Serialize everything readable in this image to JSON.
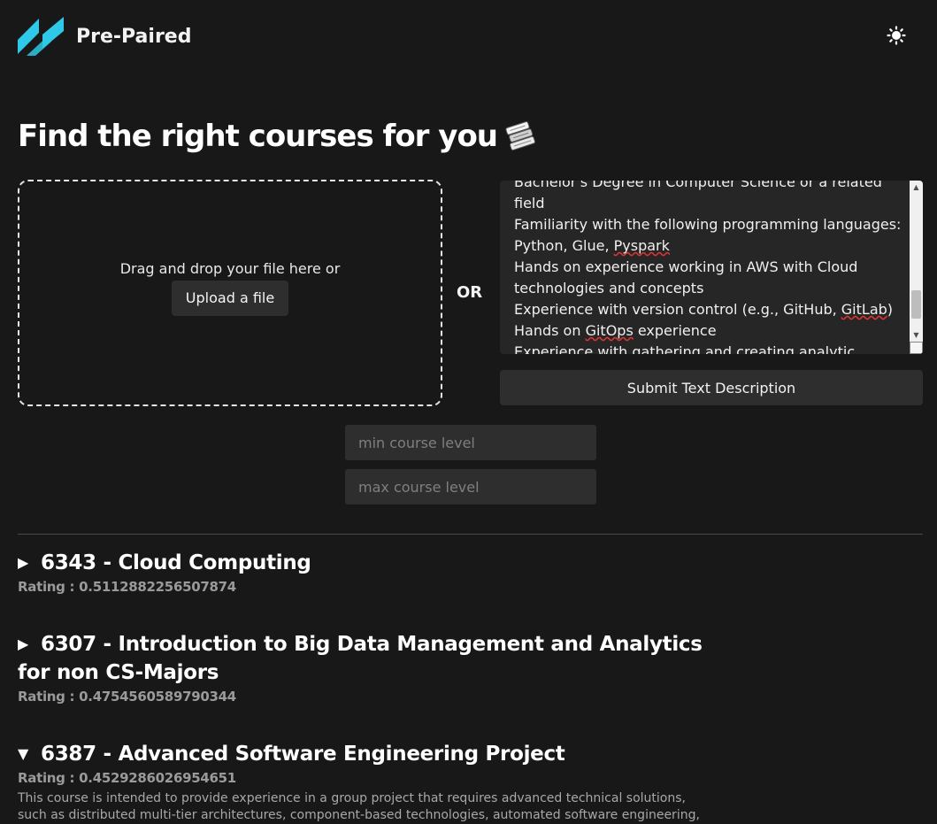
{
  "app": {
    "brand": "Pre-Paired",
    "accent_color": "#2ec9e8",
    "theme_toggle_icon": "sun-icon"
  },
  "main": {
    "title": "Find the right courses for you",
    "title_icon": "books-icon"
  },
  "upload": {
    "prompt": "Drag and drop your file here or",
    "button_label": "Upload a file"
  },
  "or_label": "OR",
  "description": {
    "lines": [
      "Bachelor's Degree in Computer Science or a related field",
      "Familiarity with the following programming languages: Python, Glue, Pyspark",
      "Hands on experience working in AWS with Cloud technologies and concepts",
      "Experience with version control (e.g., GitHub, GitLab)",
      "Hands on GitOps experience",
      "Experience with gathering and creating analytic business requirements, researching potential data"
    ],
    "submit_label": "Submit Text Description"
  },
  "filters": {
    "min_placeholder": "min course level",
    "max_placeholder": "max course level"
  },
  "courses": [
    {
      "title": "6343 - Cloud Computing",
      "rating_label": "Rating :",
      "rating": "0.5112882256507874",
      "expanded": false
    },
    {
      "title": "6307 - Introduction to Big Data Management and Analytics for non CS-Majors",
      "rating_label": "Rating :",
      "rating": "0.4754560589790344",
      "expanded": false
    },
    {
      "title": "6387 - Advanced Software Engineering Project",
      "rating_label": "Rating :",
      "rating": "0.4529286026954651",
      "expanded": true,
      "description": "This course is intended to provide experience in a group project that requires advanced technical solutions, such as distributed multi-tier architectures, component-based technologies, automated software engineering, etc., for"
    }
  ]
}
